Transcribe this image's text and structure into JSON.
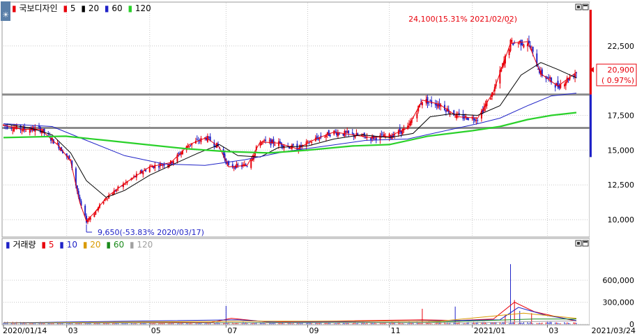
{
  "price_panel": {
    "stock_name": "국보디자인",
    "ma_legend": [
      {
        "label": "5",
        "color": "#e8000b"
      },
      {
        "label": "20",
        "color": "#000000"
      },
      {
        "label": "60",
        "color": "#1f22c7"
      },
      {
        "label": "120",
        "color": "#2ad12a"
      }
    ],
    "high_annotation": "24,100(15.31% 2021/02/02)",
    "low_annotation": "9,650(-53.83% 2020/03/17)",
    "current_price": "20,900",
    "current_change": "( 0.97%)",
    "panel_icon": "sun-icon"
  },
  "volume_panel": {
    "title": "거래량",
    "ma_legend": [
      {
        "label": "5",
        "color": "#e8000b"
      },
      {
        "label": "10",
        "color": "#1f22c7"
      },
      {
        "label": "20",
        "color": "#d99a00"
      },
      {
        "label": "60",
        "color": "#1a8a1a"
      },
      {
        "label": "120",
        "color": "#a0a0a0"
      }
    ]
  },
  "window_buttons": [
    "restore-icon",
    "maximize-icon"
  ],
  "x_axis_labels": [
    {
      "label": "2020/01/14",
      "date": "2020-01-14"
    },
    {
      "label": "03",
      "date": "2020-03-02"
    },
    {
      "label": "05",
      "date": "2020-05-04"
    },
    {
      "label": "07",
      "date": "2020-07-01"
    },
    {
      "label": "09",
      "date": "2020-09-01"
    },
    {
      "label": "11",
      "date": "2020-11-02"
    },
    {
      "label": "2021/01",
      "date": "2021-01-04"
    },
    {
      "label": "03",
      "date": "2021-03-02"
    },
    {
      "label": "2021/03/24",
      "date": "2021-03-24"
    }
  ],
  "chart_data": [
    {
      "type": "candlestick",
      "title": "",
      "x_range": [
        "2020-01-14",
        "2021-03-24"
      ],
      "ylim": [
        8800,
        25600
      ],
      "y_ticks": [
        {
          "value": 10000,
          "label": "10,000"
        },
        {
          "value": 12500,
          "label": "12,500"
        },
        {
          "value": 15000,
          "label": "15,000"
        },
        {
          "value": 17500,
          "label": "17,500"
        },
        {
          "value": 22500,
          "label": "22,500"
        }
      ],
      "horizontal_lines": [
        19000,
        16600
      ],
      "series": [
        {
          "name": "5",
          "values": [
            [
              "2020-01-14",
              16800
            ],
            [
              "2020-01-28",
              16500
            ],
            [
              "2020-02-11",
              16500
            ],
            [
              "2020-02-25",
              15300
            ],
            [
              "2020-03-05",
              14200
            ],
            [
              "2020-03-12",
              11200
            ],
            [
              "2020-03-17",
              9900
            ],
            [
              "2020-03-24",
              10600
            ],
            [
              "2020-04-01",
              11600
            ],
            [
              "2020-04-15",
              12600
            ],
            [
              "2020-05-04",
              13800
            ],
            [
              "2020-05-20",
              14100
            ],
            [
              "2020-06-03",
              15400
            ],
            [
              "2020-06-16",
              15900
            ],
            [
              "2020-06-26",
              15200
            ],
            [
              "2020-07-03",
              13800
            ],
            [
              "2020-07-17",
              13900
            ],
            [
              "2020-07-27",
              15600
            ],
            [
              "2020-08-10",
              15500
            ],
            [
              "2020-08-24",
              15100
            ],
            [
              "2020-09-07",
              15800
            ],
            [
              "2020-09-21",
              16300
            ],
            [
              "2020-10-05",
              16100
            ],
            [
              "2020-10-19",
              15900
            ],
            [
              "2020-11-02",
              16000
            ],
            [
              "2020-11-16",
              16600
            ],
            [
              "2020-11-27",
              18600
            ],
            [
              "2020-12-10",
              18300
            ],
            [
              "2020-12-24",
              17400
            ],
            [
              "2021-01-08",
              17300
            ],
            [
              "2021-01-20",
              19200
            ],
            [
              "2021-02-02",
              22700
            ],
            [
              "2021-02-15",
              22800
            ],
            [
              "2021-02-25",
              20500
            ],
            [
              "2021-03-10",
              19600
            ],
            [
              "2021-03-24",
              20600
            ]
          ]
        },
        {
          "name": "20",
          "values": [
            [
              "2020-01-14",
              16900
            ],
            [
              "2020-02-03",
              16600
            ],
            [
              "2020-02-20",
              16100
            ],
            [
              "2020-03-05",
              14800
            ],
            [
              "2020-03-17",
              12800
            ],
            [
              "2020-04-01",
              11600
            ],
            [
              "2020-04-15",
              12100
            ],
            [
              "2020-05-04",
              13200
            ],
            [
              "2020-05-20",
              13900
            ],
            [
              "2020-06-10",
              14800
            ],
            [
              "2020-06-26",
              15400
            ],
            [
              "2020-07-10",
              14600
            ],
            [
              "2020-07-27",
              14500
            ],
            [
              "2020-08-10",
              15200
            ],
            [
              "2020-09-01",
              15300
            ],
            [
              "2020-09-21",
              15800
            ],
            [
              "2020-10-12",
              16100
            ],
            [
              "2020-11-02",
              15900
            ],
            [
              "2020-11-20",
              16200
            ],
            [
              "2020-12-03",
              17400
            ],
            [
              "2020-12-18",
              17600
            ],
            [
              "2021-01-08",
              17500
            ],
            [
              "2021-01-25",
              18200
            ],
            [
              "2021-02-10",
              20400
            ],
            [
              "2021-02-25",
              21300
            ],
            [
              "2021-03-10",
              20800
            ],
            [
              "2021-03-24",
              20200
            ]
          ]
        },
        {
          "name": "60",
          "values": [
            [
              "2020-01-14",
              16900
            ],
            [
              "2020-02-20",
              16700
            ],
            [
              "2020-03-17",
              15700
            ],
            [
              "2020-04-15",
              14600
            ],
            [
              "2020-05-15",
              14000
            ],
            [
              "2020-06-15",
              13900
            ],
            [
              "2020-07-15",
              14300
            ],
            [
              "2020-08-15",
              14900
            ],
            [
              "2020-09-15",
              15300
            ],
            [
              "2020-10-15",
              15700
            ],
            [
              "2020-11-16",
              15800
            ],
            [
              "2020-12-10",
              16300
            ],
            [
              "2021-01-08",
              16900
            ],
            [
              "2021-01-25",
              17300
            ],
            [
              "2021-02-15",
              18200
            ],
            [
              "2021-03-05",
              18900
            ],
            [
              "2021-03-24",
              19100
            ]
          ]
        },
        {
          "name": "120",
          "values": [
            [
              "2020-01-14",
              15900
            ],
            [
              "2020-03-01",
              16000
            ],
            [
              "2020-04-01",
              15700
            ],
            [
              "2020-05-01",
              15400
            ],
            [
              "2020-06-01",
              15100
            ],
            [
              "2020-07-01",
              14900
            ],
            [
              "2020-08-03",
              14800
            ],
            [
              "2020-09-01",
              15000
            ],
            [
              "2020-10-05",
              15300
            ],
            [
              "2020-11-02",
              15400
            ],
            [
              "2020-12-01",
              16000
            ],
            [
              "2021-01-04",
              16400
            ],
            [
              "2021-01-25",
              16700
            ],
            [
              "2021-02-15",
              17200
            ],
            [
              "2021-03-05",
              17500
            ],
            [
              "2021-03-24",
              17700
            ]
          ]
        }
      ]
    },
    {
      "type": "bar",
      "title": "거래량",
      "ylim": [
        0,
        1000000
      ],
      "y_ticks": [
        {
          "value": 0,
          "label": "0"
        },
        {
          "value": 300000,
          "label": "300,000"
        },
        {
          "value": 600000,
          "label": "600,000"
        }
      ],
      "spikes": [
        [
          "2020-07-01",
          250000
        ],
        [
          "2020-11-27",
          210000
        ],
        [
          "2020-12-22",
          240000
        ],
        [
          "2021-01-29",
          130000
        ],
        [
          "2021-02-02",
          820000
        ],
        [
          "2021-02-05",
          330000
        ],
        [
          "2021-02-09",
          180000
        ],
        [
          "2021-02-18",
          150000
        ]
      ],
      "series": [
        {
          "name": "5",
          "values": [
            [
              "2020-01-14",
              20000
            ],
            [
              "2020-06-20",
              25000
            ],
            [
              "2020-07-05",
              80000
            ],
            [
              "2020-08-01",
              30000
            ],
            [
              "2020-11-27",
              60000
            ],
            [
              "2020-12-24",
              50000
            ],
            [
              "2021-01-20",
              70000
            ],
            [
              "2021-02-05",
              300000
            ],
            [
              "2021-02-20",
              170000
            ],
            [
              "2021-03-24",
              40000
            ]
          ]
        },
        {
          "name": "10",
          "values": [
            [
              "2020-01-14",
              18000
            ],
            [
              "2020-07-10",
              60000
            ],
            [
              "2020-08-10",
              25000
            ],
            [
              "2020-12-01",
              45000
            ],
            [
              "2021-01-25",
              60000
            ],
            [
              "2021-02-08",
              230000
            ],
            [
              "2021-03-01",
              120000
            ],
            [
              "2021-03-24",
              50000
            ]
          ]
        },
        {
          "name": "20",
          "values": [
            [
              "2020-01-14",
              16000
            ],
            [
              "2020-07-15",
              40000
            ],
            [
              "2020-12-10",
              40000
            ],
            [
              "2021-02-12",
              150000
            ],
            [
              "2021-03-24",
              80000
            ]
          ]
        },
        {
          "name": "60",
          "values": [
            [
              "2020-01-14",
              15000
            ],
            [
              "2020-12-01",
              25000
            ],
            [
              "2021-02-20",
              70000
            ],
            [
              "2021-03-24",
              70000
            ]
          ]
        },
        {
          "name": "120",
          "values": [
            [
              "2020-01-14",
              15000
            ],
            [
              "2021-01-01",
              20000
            ],
            [
              "2021-03-24",
              45000
            ]
          ]
        }
      ]
    }
  ]
}
